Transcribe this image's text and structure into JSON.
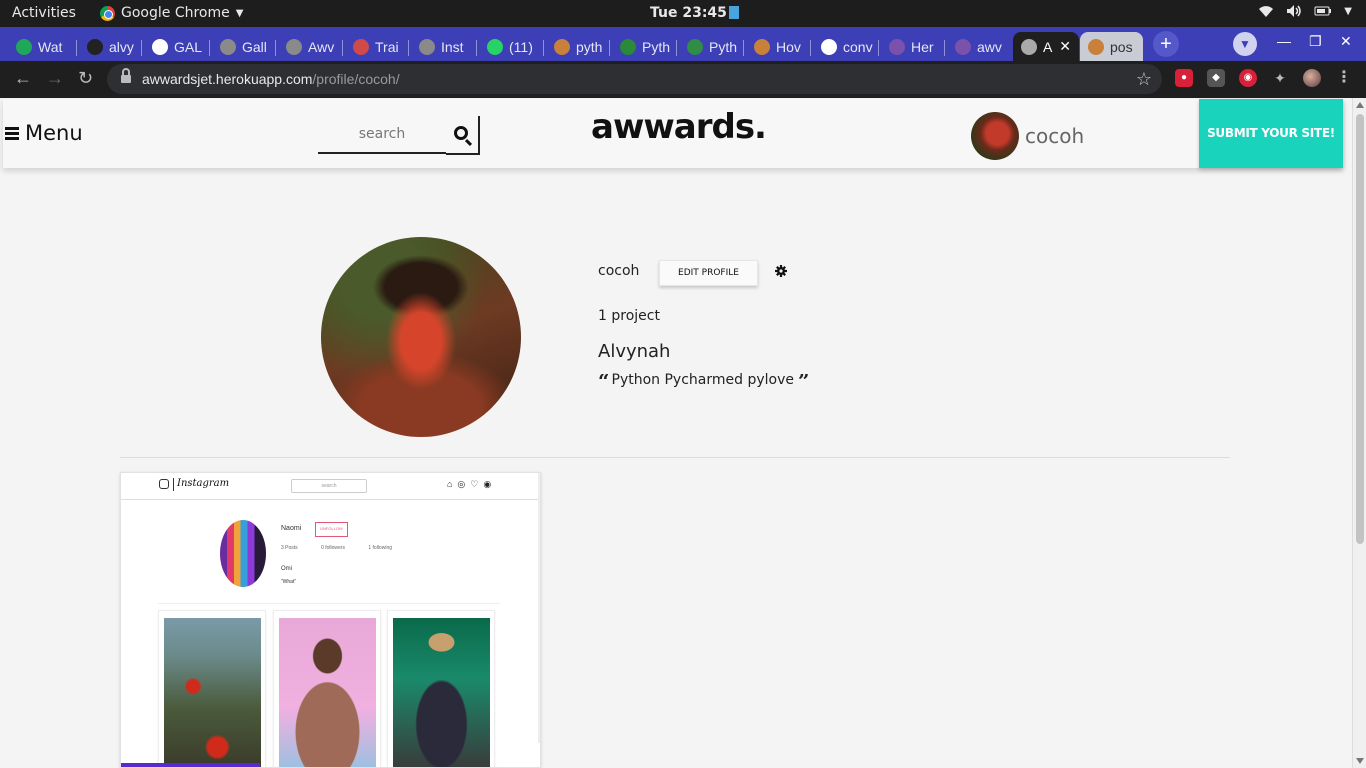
{
  "system_bar": {
    "activities": "Activities",
    "app_name": "Google Chrome",
    "clock": "Tue 23:45"
  },
  "tabs": [
    {
      "title": "Wat",
      "favicon": "tv-icon",
      "color": "#1fa85a"
    },
    {
      "title": "alvy",
      "favicon": "github-icon",
      "color": "#222222"
    },
    {
      "title": "GAL",
      "favicon": "google-icon",
      "color": "#ffffff"
    },
    {
      "title": "Gall",
      "favicon": "globe-icon",
      "color": "#8a8a8a"
    },
    {
      "title": "Awv",
      "favicon": "globe-icon",
      "color": "#8a8a8a"
    },
    {
      "title": "Trai",
      "favicon": "trello-icon",
      "color": "#d04a4a"
    },
    {
      "title": "Inst",
      "favicon": "globe-icon",
      "color": "#8a8a8a"
    },
    {
      "title": "(11)",
      "favicon": "whatsapp-icon",
      "color": "#25d366"
    },
    {
      "title": "pyth",
      "favicon": "stackoverflow-icon",
      "color": "#c8803a"
    },
    {
      "title": "Pyth",
      "favicon": "w-icon",
      "color": "#2a8a3a"
    },
    {
      "title": "Pyth",
      "favicon": "geeks-icon",
      "color": "#2f8d46"
    },
    {
      "title": "Hov",
      "favicon": "stackoverflow-icon",
      "color": "#c8803a"
    },
    {
      "title": "conv",
      "favicon": "google-icon",
      "color": "#ffffff"
    },
    {
      "title": "Her",
      "favicon": "heroku-icon",
      "color": "#7b52ab"
    },
    {
      "title": "awv",
      "favicon": "heroku-icon",
      "color": "#7b52ab"
    },
    {
      "title": "A",
      "favicon": "globe-icon",
      "color": "#aaaaaa",
      "active": true
    },
    {
      "title": "pos",
      "favicon": "stackoverflow-icon",
      "color": "#c8803a"
    }
  ],
  "address_bar": {
    "host": "awwardsjet.herokuapp.com",
    "path": "/profile/cocoh/"
  },
  "site_nav": {
    "menu_label": "Menu",
    "search_placeholder": "search",
    "brand": "awwards.",
    "username": "cocoh",
    "submit_label": "SUBMIT YOUR SITE!",
    "submit_color": "#1ad3bd"
  },
  "profile": {
    "username": "cocoh",
    "edit_label": "EDIT PROFILE",
    "projects": "1 project",
    "name": "Alvynah",
    "bio": "Python Pycharmed pylove"
  },
  "project_preview": {
    "nav_word": "Instagram",
    "search_text": "search",
    "name": "Naomi",
    "follow_label": "UNFOLLOW",
    "stats": [
      "3 Posts",
      "0 followers",
      "1 following"
    ],
    "bio_name": "Omi",
    "bio": "What"
  }
}
